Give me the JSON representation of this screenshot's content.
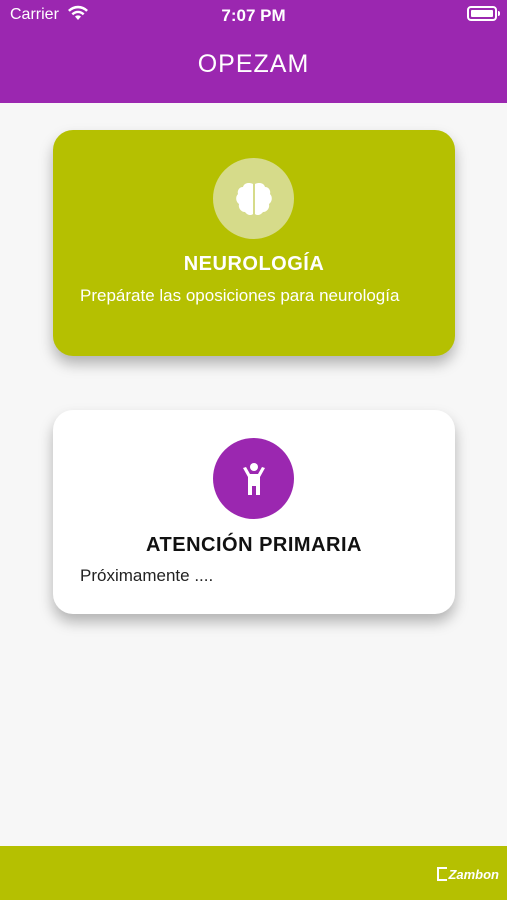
{
  "status_bar": {
    "carrier": "Carrier",
    "time": "7:07 PM"
  },
  "header": {
    "title": "OPEZAM"
  },
  "cards": [
    {
      "title": "NEUROLOGÍA",
      "description": "Prepárate las oposiciones para neurología",
      "icon": "brain-icon",
      "color": "#b5c001"
    },
    {
      "title": "ATENCIÓN PRIMARIA",
      "description": "Próximamente ....",
      "icon": "child-icon",
      "color": "#ffffff"
    }
  ],
  "footer": {
    "brand": "Zambon"
  },
  "colors": {
    "primary": "#9b27b0",
    "accent": "#b5c001"
  }
}
